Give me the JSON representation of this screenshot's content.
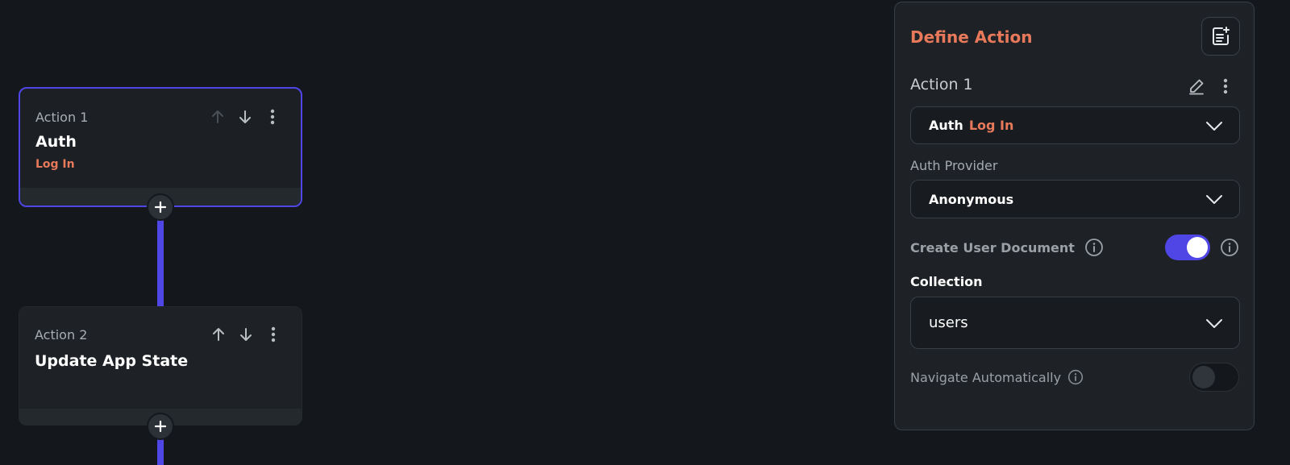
{
  "canvas": {
    "action_cards": [
      {
        "label": "Action 1",
        "title": "Auth",
        "subtitle": "Log In",
        "selected": true
      },
      {
        "label": "Action 2",
        "title": "Update App State",
        "subtitle": "",
        "selected": false
      }
    ]
  },
  "panel": {
    "title": "Define Action",
    "action_name": "Action 1",
    "action_dropdown": {
      "category": "Auth",
      "action": "Log In"
    },
    "auth_provider": {
      "label": "Auth Provider",
      "value": "Anonymous"
    },
    "create_user_document": {
      "label": "Create User Document",
      "enabled": true
    },
    "collection": {
      "label": "Collection",
      "value": "users"
    },
    "navigate_automatically": {
      "label": "Navigate Automatically",
      "enabled": false
    }
  },
  "colors": {
    "accent": "#4f46e5",
    "highlight": "#e8795a",
    "background": "#14171b",
    "panel": "#1e2226"
  }
}
